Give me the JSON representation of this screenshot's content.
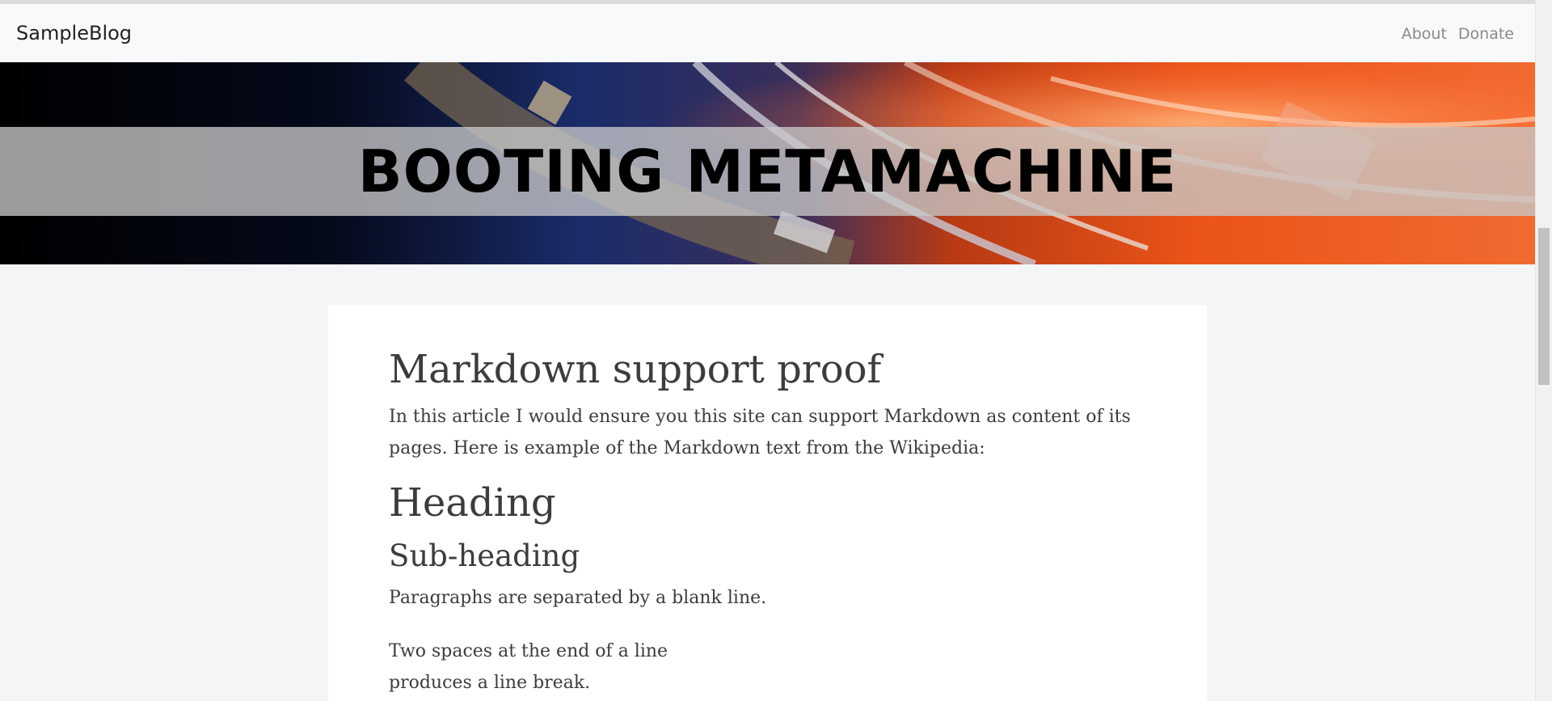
{
  "navbar": {
    "brand": "SampleBlog",
    "links": [
      "About",
      "Donate"
    ]
  },
  "hero": {
    "title": "BOOTING METAMACHINE"
  },
  "article": {
    "title": "Markdown support proof",
    "intro": "In this article I would ensure you this site can support Markdown as content of its pages. Here is example of the Markdown text from the Wikipedia:",
    "heading": "Heading",
    "subheading": "Sub-heading",
    "paragraph1": "Paragraphs are separated by a blank line.",
    "paragraph2_line1": "Two spaces at the end of a line",
    "paragraph2_line2": "produces a line break."
  },
  "colors": {
    "navbar_bg": "#f8f9fa",
    "page_bg": "#f4f5f7",
    "article_bg": "#ffffff",
    "text": "#3c3c3c",
    "nav_link": "#8a8a8a"
  }
}
